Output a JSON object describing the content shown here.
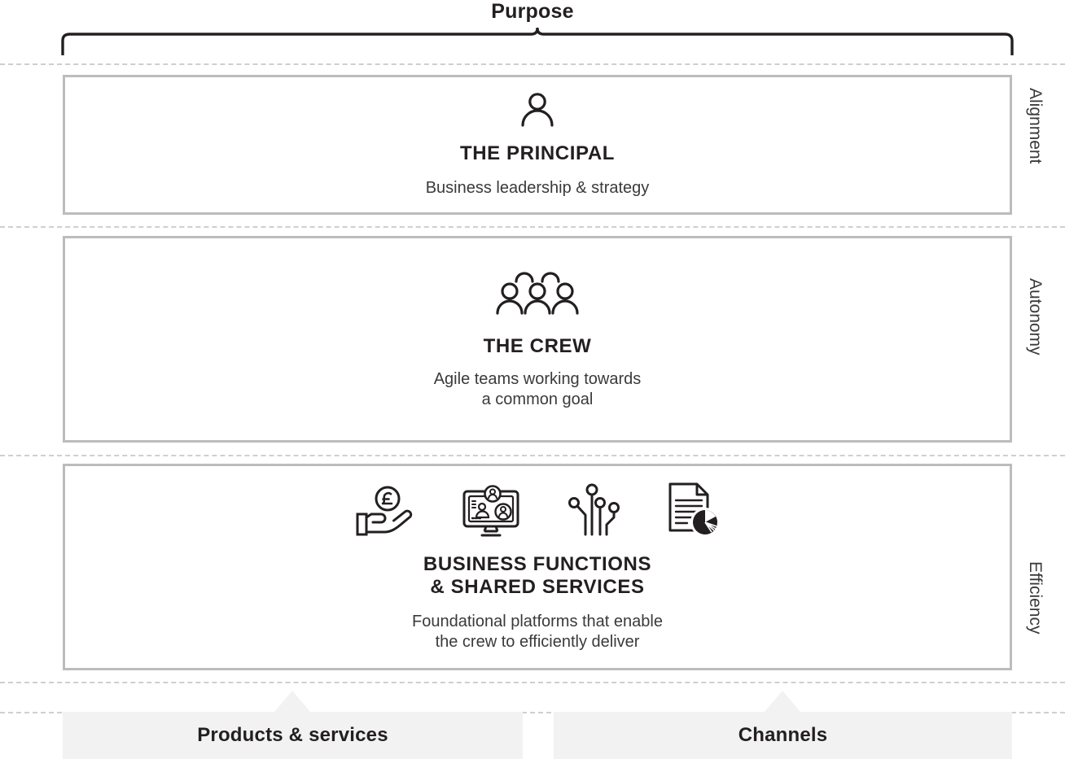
{
  "header": {
    "purpose_label": "Purpose"
  },
  "layers": [
    {
      "id": "principal",
      "icon": "person-icon",
      "title": "THE PRINCIPAL",
      "description": "Business leadership & strategy",
      "side_label": "Alignment"
    },
    {
      "id": "crew",
      "icon": "people-group-icon",
      "title": "THE CREW",
      "description_line1": "Agile teams working towards",
      "description_line2": "a common goal",
      "side_label": "Autonomy"
    },
    {
      "id": "business-functions",
      "icons": [
        "hand-with-pound-coin-icon",
        "monitor-video-conference-icon",
        "circuit-board-icon",
        "document-pie-chart-icon"
      ],
      "title_line1": "BUSINESS FUNCTIONS",
      "title_line2": "& SHARED SERVICES",
      "description_line1": "Foundational platforms that enable",
      "description_line2": "the crew to efficiently deliver",
      "side_label": "Efficiency"
    }
  ],
  "footer": {
    "boxes": [
      {
        "label": "Products & services"
      },
      {
        "label": "Channels"
      }
    ]
  },
  "colors": {
    "text_dark": "#231f20",
    "text_body": "#3a3a3a",
    "box_border": "#bcbcbc",
    "dash_line": "#cfcfcf",
    "footer_fill": "#f2f2f2",
    "icon_stroke": "#231f20",
    "background": "#ffffff"
  }
}
